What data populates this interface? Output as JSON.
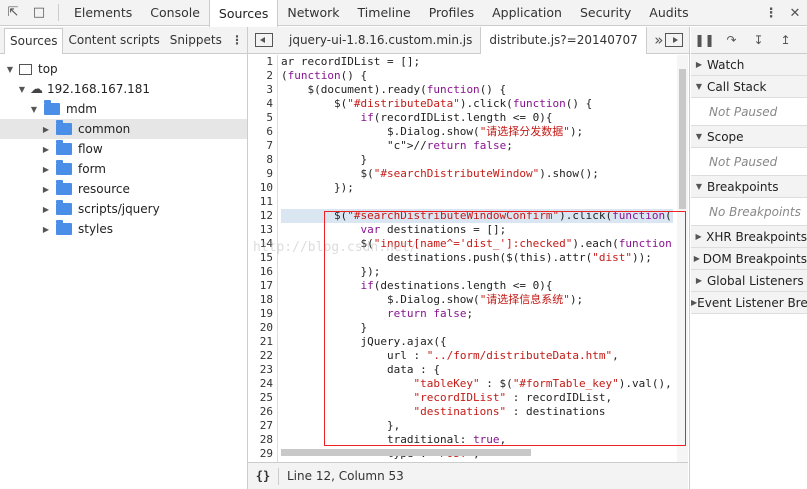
{
  "main_tabs": [
    "Elements",
    "Console",
    "Sources",
    "Network",
    "Timeline",
    "Profiles",
    "Application",
    "Security",
    "Audits"
  ],
  "navigator": {
    "tabs": [
      "Sources",
      "Content scripts",
      "Snippets"
    ],
    "tree": [
      {
        "label": "top",
        "type": "frame",
        "indent": 0
      },
      {
        "label": "192.168.167.181",
        "type": "cloud",
        "indent": 1
      },
      {
        "label": "mdm",
        "type": "folder-open",
        "indent": 2
      },
      {
        "label": "common",
        "type": "folder",
        "indent": 3,
        "selected": true
      },
      {
        "label": "flow",
        "type": "folder",
        "indent": 3
      },
      {
        "label": "form",
        "type": "folder",
        "indent": 3
      },
      {
        "label": "resource",
        "type": "folder",
        "indent": 3
      },
      {
        "label": "scripts/jquery",
        "type": "folder",
        "indent": 3
      },
      {
        "label": "styles",
        "type": "folder",
        "indent": 3
      }
    ]
  },
  "editor": {
    "files": [
      "jquery-ui-1.8.16.custom.min.js",
      "distribute.js?=20140707"
    ],
    "active_file": 1,
    "status": "Line 12, Column 53",
    "pretty_print": "{}"
  },
  "debugger": {
    "panes": [
      {
        "title": "Watch"
      },
      {
        "title": "Call Stack",
        "body": "Not Paused"
      },
      {
        "title": "Scope",
        "body": "Not Paused"
      },
      {
        "title": "Breakpoints",
        "body": "No Breakpoints"
      },
      {
        "title": "XHR Breakpoints"
      },
      {
        "title": "DOM Breakpoints"
      },
      {
        "title": "Global Listeners"
      },
      {
        "title": "Event Listener Breakpoints"
      }
    ]
  },
  "code_lines": [
    "ar recordIDList = [];",
    "(function() {",
    "    $(document).ready(function() {",
    "        $(\"#distributeData\").click(function() {",
    "            if(recordIDList.length <= 0){",
    "                $.Dialog.show(\"请选择分发数据\");",
    "                //return false;",
    "            }",
    "            $(\"#searchDistributeWindow\").show();",
    "        });",
    "",
    "        $(\"#searchDistributeWindowConfirm\").click(function(){",
    "            var destinations = [];",
    "            $(\"input[name^='dist_']:checked\").each(function(){",
    "                destinations.push($(this).attr(\"dist\"));",
    "            });",
    "            if(destinations.length <= 0){",
    "                $.Dialog.show(\"请选择信息系统\");",
    "                return false;",
    "            }",
    "            jQuery.ajax({",
    "                url : \"../form/distributeData.htm\",",
    "                data : {",
    "                    \"tableKey\" : $(\"#formTable_key\").val(),",
    "                    \"recordIDList\" : recordIDList,",
    "                    \"destinations\" : destinations",
    "                },",
    "                traditional: true,",
    "                type : \"POST\","
  ],
  "watermark": "http://blog.csdn.net/"
}
